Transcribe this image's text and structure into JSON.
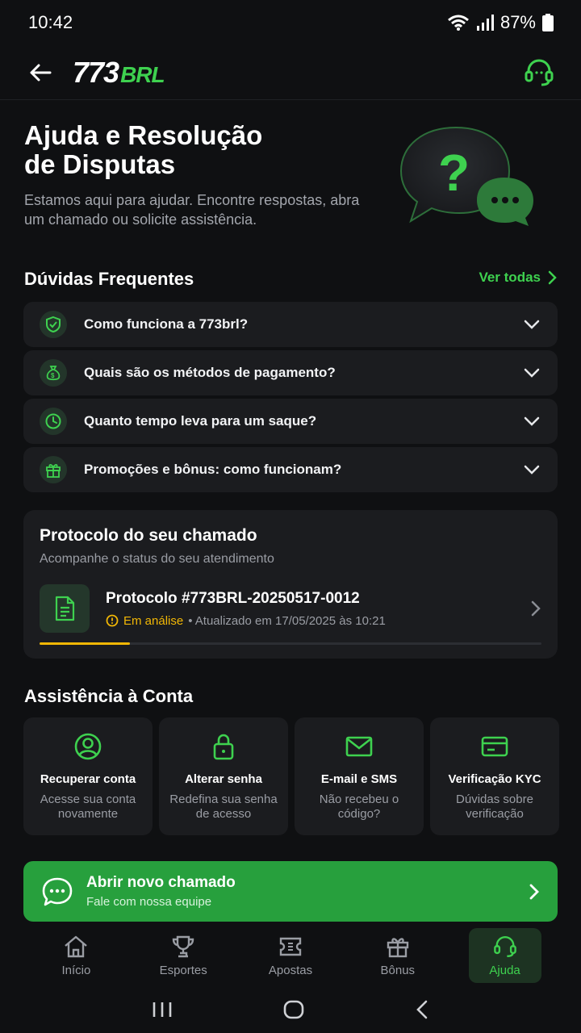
{
  "status_bar": {
    "time": "10:42",
    "battery": "87%"
  },
  "header": {
    "logo_part1": "773",
    "logo_part2": "BRL"
  },
  "hero": {
    "title_line1": "Ajuda e Resolução",
    "title_line2": "de Disputas",
    "subtitle": "Estamos aqui para ajudar. Encontre respostas, abra um chamado ou solicite assistência."
  },
  "faq": {
    "title": "Dúvidas Frequentes",
    "see_all": "Ver todas",
    "items": [
      {
        "question": "Como funciona a 773brl?",
        "icon": "shield-check-icon"
      },
      {
        "question": "Quais são os métodos de pagamento?",
        "icon": "money-bag-icon"
      },
      {
        "question": "Quanto tempo leva para um saque?",
        "icon": "clock-icon"
      },
      {
        "question": "Promoções e bônus: como funcionam?",
        "icon": "gift-icon"
      }
    ]
  },
  "protocol": {
    "title": "Protocolo do seu chamado",
    "subtitle": "Acompanhe o status do seu atendimento",
    "number": "Protocolo #773BRL-20250517-0012",
    "status": "Em análise",
    "updated": "• Atualizado em 17/05/2025 às 10:21",
    "progress": 0.18
  },
  "assistance": {
    "title": "Assistência à Conta",
    "cards": [
      {
        "title": "Recuperar conta",
        "desc": "Acesse sua conta novamente",
        "icon": "user-circle-icon"
      },
      {
        "title": "Alterar senha",
        "desc": "Redefina sua senha de acesso",
        "icon": "lock-icon"
      },
      {
        "title": "E-mail e SMS",
        "desc": "Não recebeu o código?",
        "icon": "mail-icon"
      },
      {
        "title": "Verificação KYC",
        "desc": "Dúvidas sobre verificação",
        "icon": "id-card-icon"
      }
    ]
  },
  "cta": {
    "title": "Abrir novo chamado",
    "subtitle": "Fale com nossa equipe"
  },
  "nav": {
    "items": [
      {
        "label": "Início",
        "icon": "home-icon"
      },
      {
        "label": "Esportes",
        "icon": "trophy-icon"
      },
      {
        "label": "Apostas",
        "icon": "ticket-icon"
      },
      {
        "label": "Bônus",
        "icon": "gift-icon"
      },
      {
        "label": "Ajuda",
        "icon": "headset-icon"
      }
    ],
    "active": "Ajuda"
  },
  "colors": {
    "accent": "#3ed14f",
    "warning": "#f2b705",
    "cta": "#27a03d",
    "background": "#0f1012",
    "card": "#1b1c1f"
  }
}
